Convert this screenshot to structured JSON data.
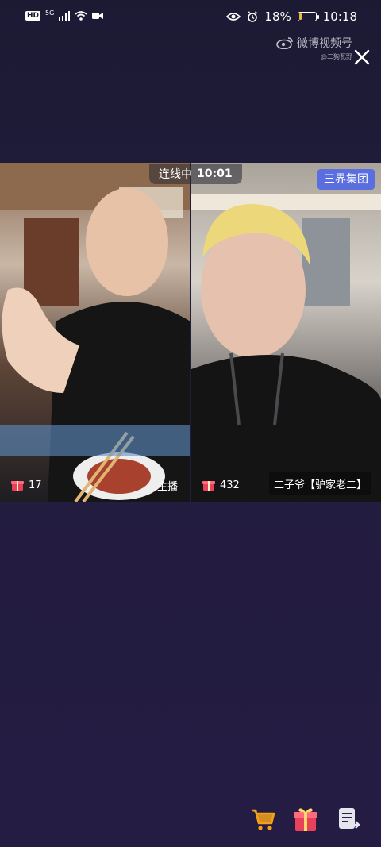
{
  "status_bar": {
    "network_badge": "HD",
    "network_type": "5G",
    "battery_percent": "18%",
    "battery_level": 0.18,
    "time": "10:18"
  },
  "watermark": {
    "title": "微博视频号",
    "subtitle": "@二狗瓦野"
  },
  "live": {
    "link_status": "连线中",
    "link_time": "10:01",
    "channel_badge": "三界集团",
    "host": {
      "gift_count": "17",
      "label": "主播"
    },
    "guest": {
      "gift_count": "432",
      "label": "二子爷【驴家老二】"
    }
  },
  "colors": {
    "background": "#201c3a",
    "channel_badge": "#5b6ee0",
    "cart": "#f3a11b",
    "gift": "#e8425a"
  },
  "actions": {
    "icons": [
      "cart-icon",
      "gift-icon",
      "list-icon"
    ]
  }
}
